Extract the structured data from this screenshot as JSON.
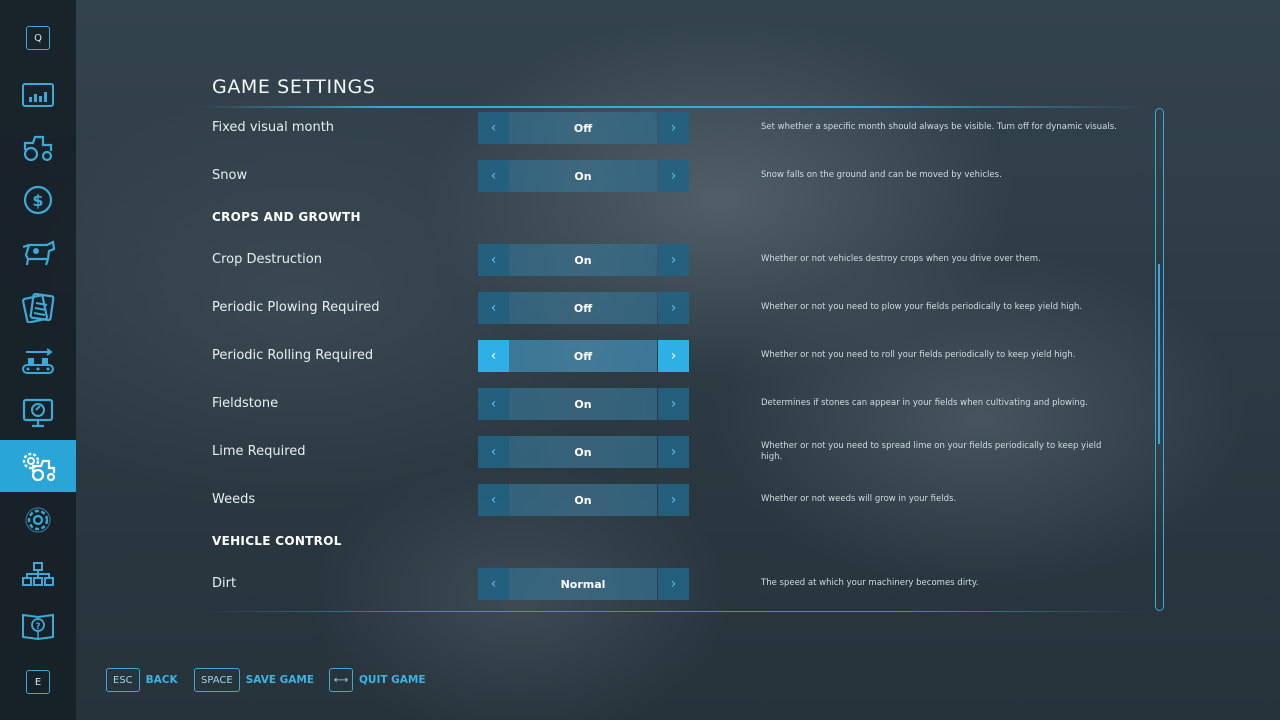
{
  "page": {
    "title": "GAME SETTINGS"
  },
  "sidebar": {
    "top_key": "Q",
    "bottom_key": "E",
    "items": [
      {
        "icon": "stats-icon"
      },
      {
        "icon": "tractor-icon"
      },
      {
        "icon": "dollar-icon"
      },
      {
        "icon": "cow-icon"
      },
      {
        "icon": "contracts-icon"
      },
      {
        "icon": "production-icon"
      },
      {
        "icon": "tour-icon"
      },
      {
        "icon": "game-settings-icon",
        "active": true
      },
      {
        "icon": "gear-icon"
      },
      {
        "icon": "network-icon"
      },
      {
        "icon": "help-book-icon"
      }
    ]
  },
  "settings": [
    {
      "label": "Fixed visual month",
      "value": "Off",
      "description": "Set whether a specific month should always be visible. Turn off for dynamic visuals."
    },
    {
      "label": "Snow",
      "value": "On",
      "description": "Snow falls on the ground and can be moved by vehicles."
    }
  ],
  "sections": {
    "crops": "CROPS AND GROWTH",
    "vehicle": "VEHICLE CONTROL"
  },
  "crops_settings": [
    {
      "label": "Crop Destruction",
      "value": "On",
      "description": "Whether or not vehicles destroy crops when you drive over them."
    },
    {
      "label": "Periodic Plowing Required",
      "value": "Off",
      "description": "Whether or not you need to plow your fields periodically to keep yield high."
    },
    {
      "label": "Periodic Rolling Required",
      "value": "Off",
      "description": "Whether or not you need to roll your fields periodically to keep yield high.",
      "focused": true
    },
    {
      "label": "Fieldstone",
      "value": "On",
      "description": "Determines if stones can appear in your fields when cultivating and plowing."
    },
    {
      "label": "Lime Required",
      "value": "On",
      "description": "Whether or not you need to spread lime on your fields periodically to keep yield high."
    },
    {
      "label": "Weeds",
      "value": "On",
      "description": "Whether or not weeds will grow in your fields."
    }
  ],
  "vehicle_settings": [
    {
      "label": "Dirt",
      "value": "Normal",
      "description": "The speed at which your machinery becomes dirty."
    }
  ],
  "footer": {
    "back_key": "ESC",
    "back_label": "BACK",
    "save_key": "SPACE",
    "save_label": "SAVE GAME",
    "quit_key": "⟷",
    "quit_label": "QUIT GAME"
  },
  "colors": {
    "accent": "#2aa5d8",
    "selector": "#346885"
  }
}
